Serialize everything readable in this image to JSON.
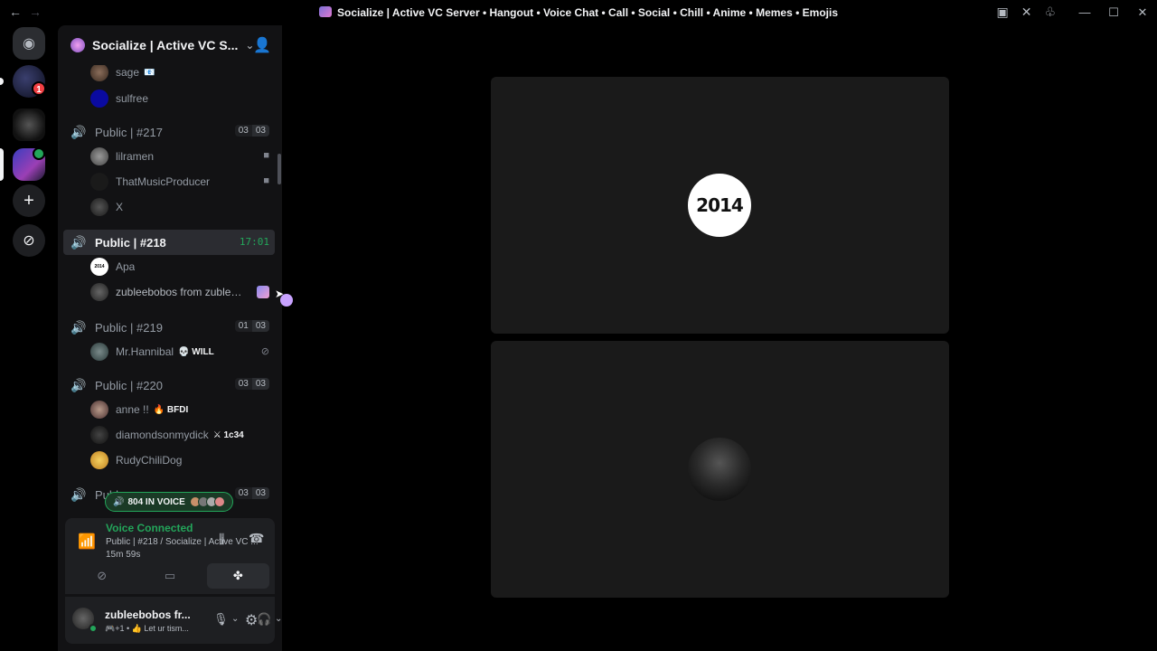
{
  "window": {
    "title": "Socialize | Active VC Server • Hangout • Voice Chat • Call • Social • Chill • Anime • Memes • Emojis",
    "back_icon": "arrow-left-icon",
    "forward_icon": "arrow-right-icon"
  },
  "rail": {
    "home_icon": "discord-logo-icon",
    "mention_badge": "1",
    "add_icon": "plus-icon",
    "discover_icon": "compass-icon"
  },
  "server": {
    "name": "Socialize | Active VC S...",
    "chevron_icon": "chevron-down-icon",
    "invite_icon": "add-user-icon"
  },
  "channels": {
    "pre_users": [
      {
        "name": "sage",
        "tag": "📧"
      },
      {
        "name": "sulfree",
        "tag": ""
      }
    ],
    "list": [
      {
        "name": "Public | #217",
        "counts": [
          "03",
          "03"
        ]
      },
      {
        "name": "Public | #218",
        "timer": "17:01",
        "active": true
      },
      {
        "name": "Public | #219",
        "counts": [
          "01",
          "03"
        ]
      },
      {
        "name": "Public | #220",
        "counts": [
          "03",
          "03"
        ]
      },
      {
        "name": "Publ",
        "counts": [
          "03",
          "03"
        ]
      }
    ],
    "users_217": [
      {
        "name": "lilramen",
        "icon": "camera-icon"
      },
      {
        "name": "ThatMusicProducer",
        "icon": "camera-icon"
      },
      {
        "name": "X"
      }
    ],
    "users_218": [
      {
        "name": "Apa",
        "avatar_text": "2014"
      },
      {
        "name": "zubleebobos from zublee..."
      }
    ],
    "users_219": [
      {
        "name": "Mr.Hannibal",
        "tag": "💀 WILL",
        "icon": "deafened-icon"
      }
    ],
    "users_220": [
      {
        "name": "anne !!",
        "tag": "🔥 BFDI"
      },
      {
        "name": "diamondsonmydick",
        "tag": "⚔ 1c34"
      },
      {
        "name": "RudyChiliDog"
      }
    ]
  },
  "voice_pill": {
    "label": "804 IN VOICE"
  },
  "voice_panel": {
    "status": "Voice Connected",
    "channel": "Public | #218 / Socialize | Active VC ...",
    "elapsed": "15m 59s"
  },
  "userbar": {
    "name": "zubleebobos fr...",
    "status": "🎮+1 • 👍 Let ur tism..."
  },
  "stage": {
    "tile1_avatar_text": "2014"
  }
}
